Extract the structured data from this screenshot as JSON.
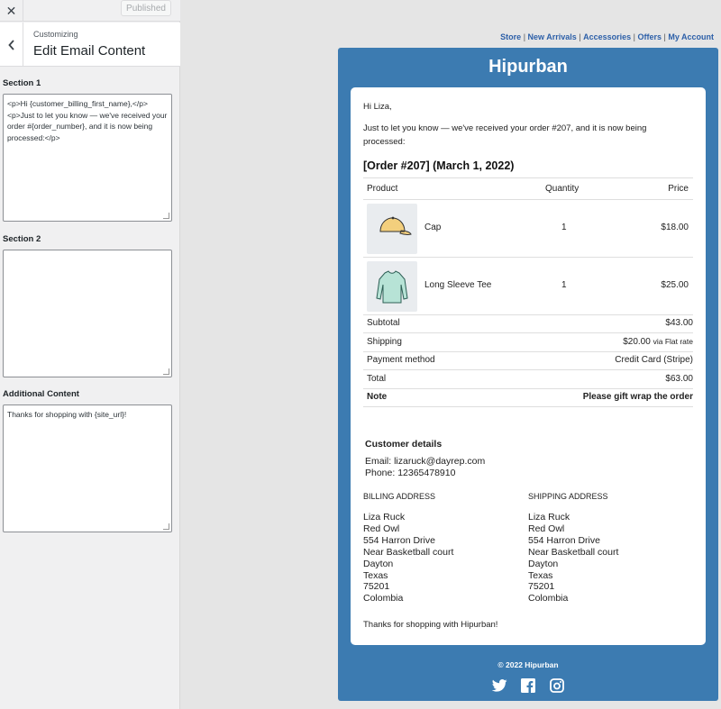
{
  "customizer": {
    "close_symbol": "✕",
    "published_label": "Published",
    "back_symbol": "‹",
    "breadcrumb": "Customizing",
    "title": "Edit Email Content",
    "section1_label": "Section 1",
    "section1_value": "<p>Hi {customer_billing_first_name},</p><p>Just to let you know — we've received your order #{order_number}, and it is now being processed:</p>",
    "section2_label": "Section 2",
    "section2_value": "",
    "additional_label": "Additional Content",
    "additional_value": "Thanks for shopping with {site_url}!"
  },
  "nav_links": [
    "Store",
    "New Arrivals",
    "Accessories",
    "Offers",
    "My Account"
  ],
  "email": {
    "brand": "Hipurban",
    "greeting": "Hi Liza,",
    "intro_line1": "Just to let you know — we've received your order #207, and it is now being",
    "intro_line2": "processed:",
    "order_heading": "[Order #207] (March 1, 2022)",
    "table_headers": {
      "product": "Product",
      "quantity": "Quantity",
      "price": "Price"
    },
    "items": [
      {
        "name": "Cap",
        "quantity": "1",
        "price": "$18.00",
        "icon": "cap-icon"
      },
      {
        "name": "Long Sleeve Tee",
        "quantity": "1",
        "price": "$25.00",
        "icon": "shirt-icon"
      }
    ],
    "totals": {
      "subtotal_label": "Subtotal",
      "subtotal_value": "$43.00",
      "shipping_label": "Shipping",
      "shipping_value": "$20.00",
      "shipping_note": "via Flat rate",
      "payment_label": "Payment method",
      "payment_value": "Credit Card (Stripe)",
      "total_label": "Total",
      "total_value": "$63.00",
      "note_label": "Note",
      "note_value": "Please gift wrap the order"
    },
    "customer_heading": "Customer details",
    "email_line": "Email: lizaruck@dayrep.com",
    "phone_line": "Phone: 12365478910",
    "billing_heading": "BILLING ADDRESS",
    "shipping_heading": "SHIPPING ADDRESS",
    "billing_lines": [
      "Liza Ruck",
      "Red Owl",
      "554 Harron Drive",
      "Near Basketball court",
      "Dayton",
      "Texas",
      "75201",
      "Colombia"
    ],
    "shipping_lines": [
      "Liza Ruck",
      "Red Owl",
      "554 Harron Drive",
      "Near Basketball court",
      "Dayton",
      "Texas",
      "75201",
      "Colombia"
    ],
    "closing": "Thanks for shopping with Hipurban!",
    "footer": "© 2022 Hipurban",
    "social_icons": [
      "twitter-icon",
      "facebook-icon",
      "instagram-icon"
    ]
  },
  "colors": {
    "brand_blue": "#3c7bb1",
    "link_blue": "#2c5fa8"
  }
}
